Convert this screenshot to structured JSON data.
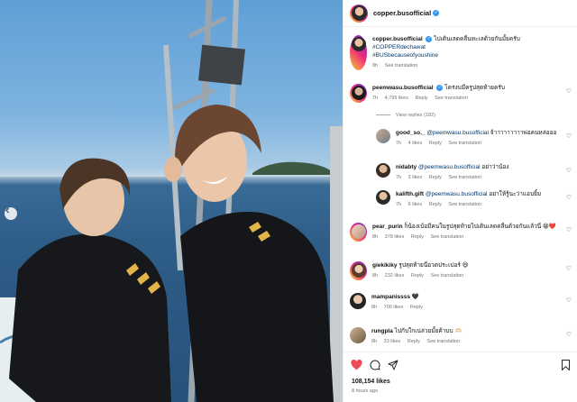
{
  "post": {
    "author": "copper.busofficial",
    "caption": {
      "user": "copper.busofficial",
      "text": "ไปเดินเลดคลื่นทะเลด้วยกันมั้ยครับ",
      "tags": [
        "#COPPERdechawat",
        "#BUSbecauseofyoushine"
      ],
      "time": "8h",
      "see_translation": "See translation"
    },
    "likes": "108,154 likes",
    "ago": "8 hours ago"
  },
  "comments": [
    {
      "user": "peemwasu.busofficial",
      "verified": true,
      "text": "โคร่งบมีครูปสุดท้ายครับ",
      "time": "7h",
      "likes": "4,799 likes",
      "reply": "Reply",
      "translate": "See translation"
    },
    {
      "user": "good_so._",
      "mention": "@peemwasu.busofficial",
      "text": "จ้าาาาาาาาาพ่อคนหล่อออ",
      "time": "7h",
      "likes": "4 likes",
      "reply": "Reply",
      "translate": "See translation"
    },
    {
      "user": "nidabty",
      "mention": "@peemwasu.busofficial",
      "text": "อย่าว่าน้อง",
      "time": "7h",
      "likes": "3 likes",
      "reply": "Reply",
      "translate": "See translation"
    },
    {
      "user": "kalifth.gift",
      "mention": "@peemwasu.busofficial",
      "text": "อย่าให้รู้นะว่าแอบยิ้ม",
      "time": "7h",
      "likes": "6 likes",
      "reply": "Reply",
      "translate": "See translation"
    },
    {
      "user": "pear_purin",
      "text": "ก็น้องเบ้อมีคนในรูปสุดท้ายไปเดินเลดคลื่นด้วยกันแล้วนี่",
      "emoji": "😁❤️",
      "time": "8h",
      "likes": "378 likes",
      "reply": "Reply",
      "translate": "See translation"
    },
    {
      "user": "giekikiky",
      "text": "รูปสุดท้ายนี่อวดประเปอร์",
      "emoji": "😆",
      "time": "8h",
      "likes": "232 likes",
      "reply": "Reply",
      "translate": "See translation"
    },
    {
      "user": "mampanissss",
      "emoji": "🖤",
      "time": "8h",
      "likes": "700 likes",
      "reply": "Reply"
    },
    {
      "user": "rungpla",
      "text": "ไปกับใกเน่ล่วยมั้ยค้าบบ",
      "emoji": "🫶🏻",
      "time": "8h",
      "likes": "33 likes",
      "reply": "Reply",
      "translate": "See translation"
    }
  ],
  "view_replies": "View replies (182)",
  "icons": [
    "heart-icon",
    "comment-icon",
    "share-icon",
    "bookmark-icon",
    "chevron-left-icon",
    "verified-icon"
  ],
  "colors": {
    "accent_like": "#ed4956",
    "link": "#00376b",
    "verified": "#3897f0"
  }
}
